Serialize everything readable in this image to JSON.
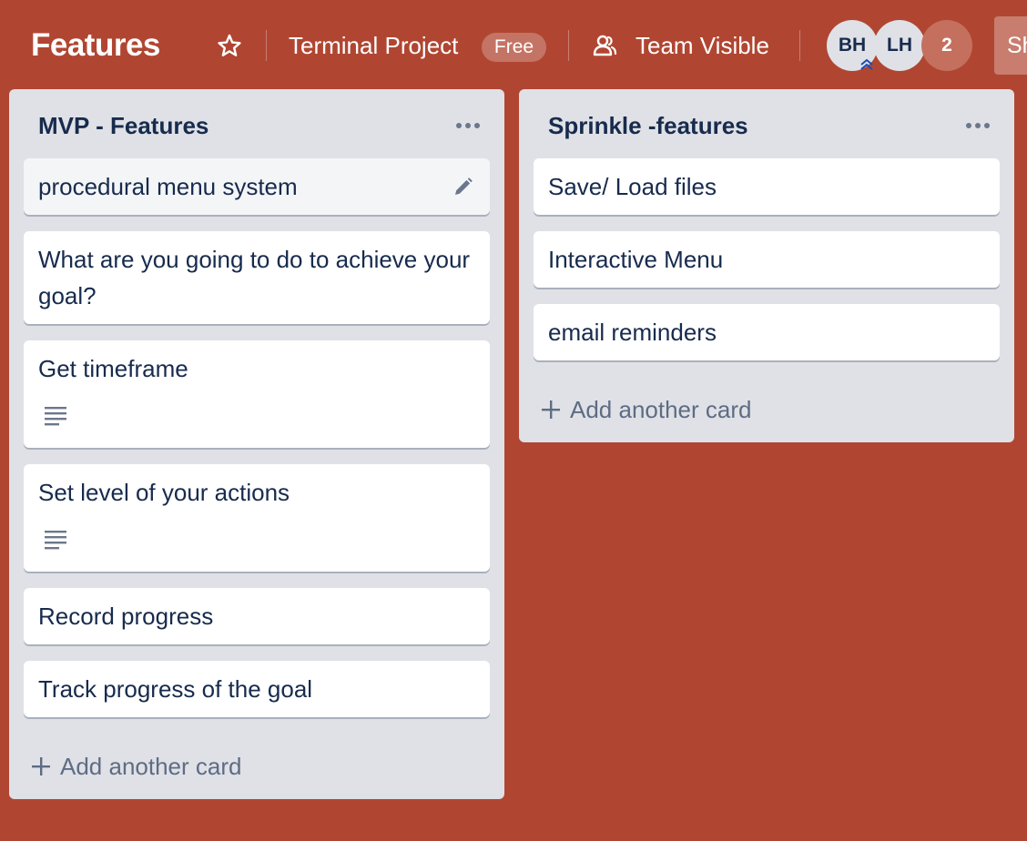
{
  "board": {
    "title": "Features",
    "project": "Terminal Project",
    "plan_badge": "Free",
    "visibility": "Team Visible",
    "members": [
      {
        "initials": "BH"
      },
      {
        "initials": "LH"
      }
    ],
    "more_members": "2",
    "share_label": "Share"
  },
  "lists": [
    {
      "title": "MVP - Features",
      "cards": [
        {
          "title": "procedural menu system"
        },
        {
          "title": "What are you going to do to achieve your goal?"
        },
        {
          "title": "Get timeframe",
          "has_description": true
        },
        {
          "title": "Set level of your actions",
          "has_description": true
        },
        {
          "title": "Record progress"
        },
        {
          "title": "Track progress of the goal"
        }
      ],
      "add_card_label": "Add another card"
    },
    {
      "title": "Sprinkle -features",
      "cards": [
        {
          "title": "Save/ Load files"
        },
        {
          "title": "Interactive Menu"
        },
        {
          "title": "email reminders"
        }
      ],
      "add_card_label": "Add another card"
    }
  ],
  "colors": {
    "board_background": "#b04632",
    "list_background": "#dfe1e6",
    "card_text": "#172b4d",
    "muted_text": "#5e6c84"
  },
  "icons": {
    "star": "star-icon",
    "team": "team-icon",
    "admin": "admin-chevron-icon",
    "list_menu": "more-horizontal-icon",
    "edit": "pencil-icon",
    "description": "description-icon",
    "add": "plus-icon"
  }
}
